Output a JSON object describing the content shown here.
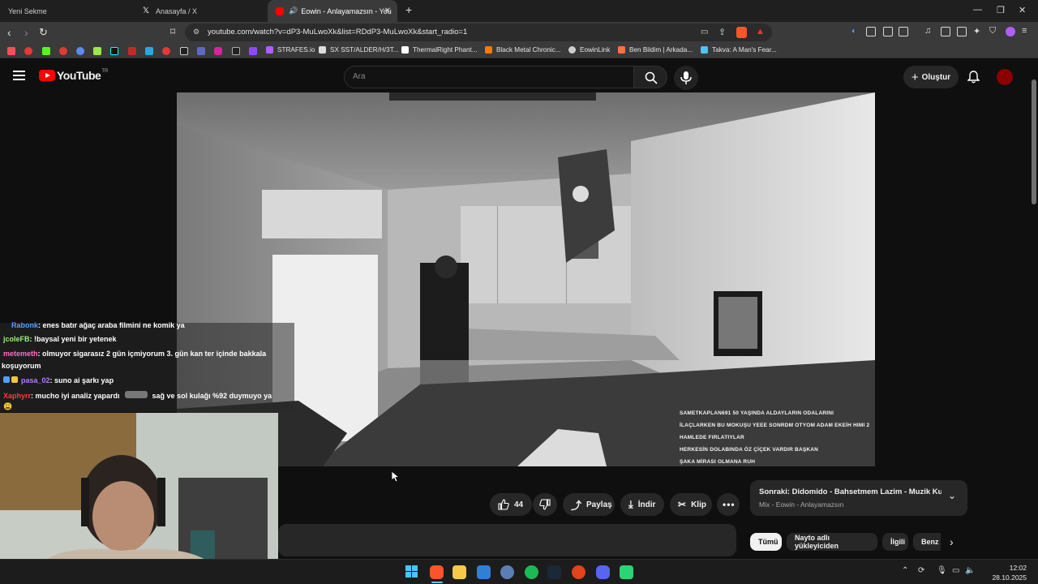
{
  "tabs": [
    {
      "label": "Yeni Sekme"
    },
    {
      "label": "Anasayfa / X"
    },
    {
      "label": "Eowin - Anlayamazsın - YouTube"
    }
  ],
  "address": {
    "url": "youtube.com/watch?v=dP3-MuLwoXk&list=RDdP3-MuLwoXk&start_radio=1"
  },
  "bookmarks": [
    {
      "label": "STRAFES.io"
    },
    {
      "label": "SX SST/ALDER/H/3T..."
    },
    {
      "label": "ThermalRight Phant..."
    },
    {
      "label": "Black Metal Chronic..."
    },
    {
      "label": "EowinLink"
    },
    {
      "label": "Ben Bildim | Arkada..."
    },
    {
      "label": "Takva: A Man's Fear..."
    }
  ],
  "youtube": {
    "logo_text": "YouTube",
    "logo_region": "TR",
    "search_placeholder": "Ara",
    "create_label": "Oluştur"
  },
  "chat": [
    {
      "user": "Rabonk",
      "user_color": "#4ea1ff",
      "text": ": enes batır ağaç araba filmini ne komik ya"
    },
    {
      "user": "jcoleFB",
      "user_color": "#9ef07a",
      "text": ": !baysal yeni bir yetenek"
    },
    {
      "user": "metemeth",
      "user_color": "#ff6ec7",
      "text": ": olmuyor sigarasız 2 gün içmiyorum 3. gün kan ter içinde bakkala"
    },
    {
      "user": "",
      "user_color": "#ffffff",
      "text": "koşuyorum"
    },
    {
      "user": "pasa_02",
      "user_color": "#b57bff",
      "text": ": suno ai şarkı yap"
    },
    {
      "user": "Xaphyrr",
      "user_color": "#ff3b3b",
      "text": ": mucho iyi analiz yapardı"
    },
    {
      "user": "",
      "user_color": "#ffffff",
      "text": "sağ ve sol kulağı %92 duymuyo ya"
    }
  ],
  "video_overlay_lines": [
    "SAMETKAPLAN691 50 YAŞINDA ALDAYLARIN ODALARINI",
    "İLAÇLARKEN BU MOKUŞU YEEE SONRDM OTYOM ADAM EKEİH HIMI 2",
    "HAMLEDE FIRLATIYLAR",
    "HERKESİN DOLABINDA ÖZ ÇİÇEK VARDIR BAŞKAN",
    "ŞAKA MİRASI OLMANA RUH"
  ],
  "actions": {
    "likes": "44",
    "share_label": "Paylaş",
    "download_label": "İndir",
    "clip_label": "Klip"
  },
  "up_next": {
    "title": "Sonraki: Didomido - Bahsetmem Lazim - Muzik Kus...",
    "subtitle": "Mix - Eowin - Anlayamazsın"
  },
  "chips": [
    {
      "label": "Tümü"
    },
    {
      "label": "Nayto adlı yükleyiciden"
    },
    {
      "label": "İlgili"
    },
    {
      "label": "Benz"
    }
  ],
  "taskbar": {
    "time": "12:02",
    "date": "28.10.2025"
  },
  "colors": {
    "yt_red": "#ff0000",
    "bg": "#0f0f0f",
    "chip_active_bg": "#f1f1f1"
  }
}
